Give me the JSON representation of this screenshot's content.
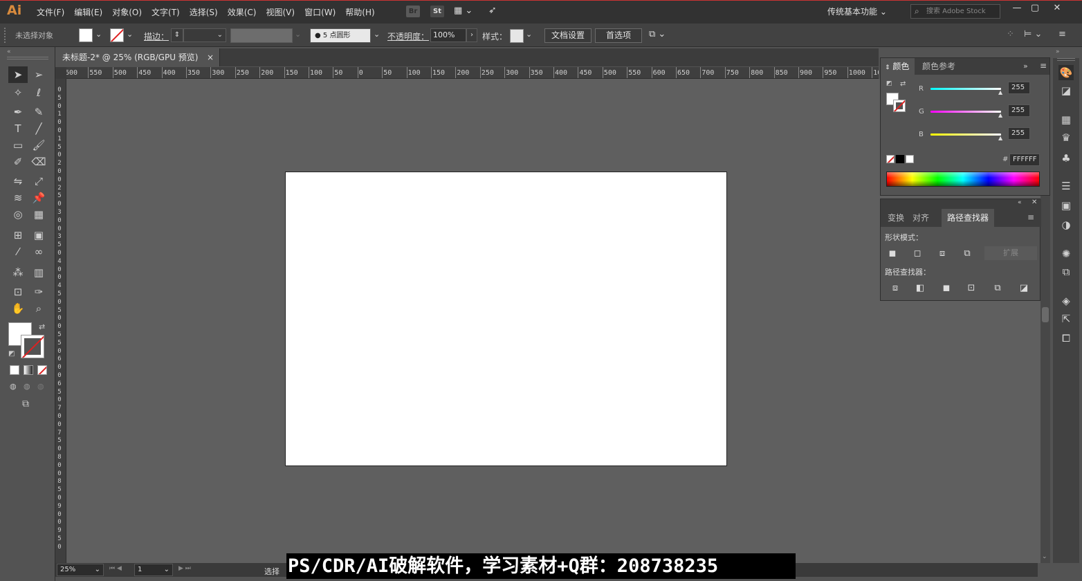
{
  "app": {
    "logo": "Ai"
  },
  "menu": [
    "文件(F)",
    "编辑(E)",
    "对象(O)",
    "文字(T)",
    "选择(S)",
    "效果(C)",
    "视图(V)",
    "窗口(W)",
    "帮助(H)"
  ],
  "menu_bar_icons": {
    "bridge": "Br",
    "stock": "St"
  },
  "workspace": "传统基本功能",
  "stock_search_placeholder": "搜索 Adobe Stock",
  "control": {
    "selection_status": "未选择对象",
    "stroke_label": "描边：",
    "brush_label": "5 点圆形",
    "opacity_label": "不透明度：",
    "opacity_value": "100%",
    "style_label": "样式：",
    "doc_setup_button": "文档设置",
    "prefs_button": "首选项"
  },
  "document_tab": {
    "title": "未标题-2* @ 25% (RGB/GPU 预览)",
    "close": "×"
  },
  "ruler_h_labels": [
    "600",
    "550",
    "500",
    "450",
    "400",
    "350",
    "300",
    "250",
    "200",
    "150",
    "100",
    "50",
    "0",
    "50",
    "100",
    "150",
    "200",
    "250",
    "300",
    "350",
    "400",
    "450",
    "500",
    "550",
    "600",
    "650",
    "700",
    "750",
    "800",
    "850",
    "900",
    "950",
    "1000",
    "10"
  ],
  "ruler_v_labels": [
    "0",
    "5",
    "0",
    "1",
    "0",
    "0",
    "1",
    "5",
    "0",
    "2",
    "0",
    "0",
    "2",
    "5",
    "0",
    "3",
    "0",
    "0",
    "3",
    "5",
    "0",
    "4",
    "0",
    "0",
    "4",
    "5",
    "0",
    "5",
    "0",
    "0",
    "5",
    "5",
    "0",
    "6",
    "0",
    "0",
    "6",
    "5",
    "0",
    "7",
    "0",
    "0",
    "7",
    "5",
    "0",
    "8",
    "0",
    "0",
    "8",
    "5",
    "0",
    "9",
    "0",
    "0",
    "9",
    "5",
    "0"
  ],
  "color_panel": {
    "tabs": [
      "颜色",
      "颜色参考"
    ],
    "r_label": "R",
    "r_value": "255",
    "g_label": "G",
    "g_value": "255",
    "b_label": "B",
    "b_value": "255",
    "hex_label": "#",
    "hex_value": "FFFFFF"
  },
  "pathfinder_panel": {
    "tabs": [
      "变换",
      "对齐",
      "路径查找器"
    ],
    "shape_modes_label": "形状模式：",
    "expand_button": "扩展",
    "pathfinders_label": "路径查找器："
  },
  "status": {
    "zoom": "25%",
    "page": "1",
    "tool_status": "选择"
  },
  "watermark": "PS/CDR/AI破解软件，学习素材+Q群：208738235",
  "colors": {
    "accent_logo": "#d98b3d",
    "canvas": "#5f5f5f",
    "artboard": "#ffffff"
  }
}
